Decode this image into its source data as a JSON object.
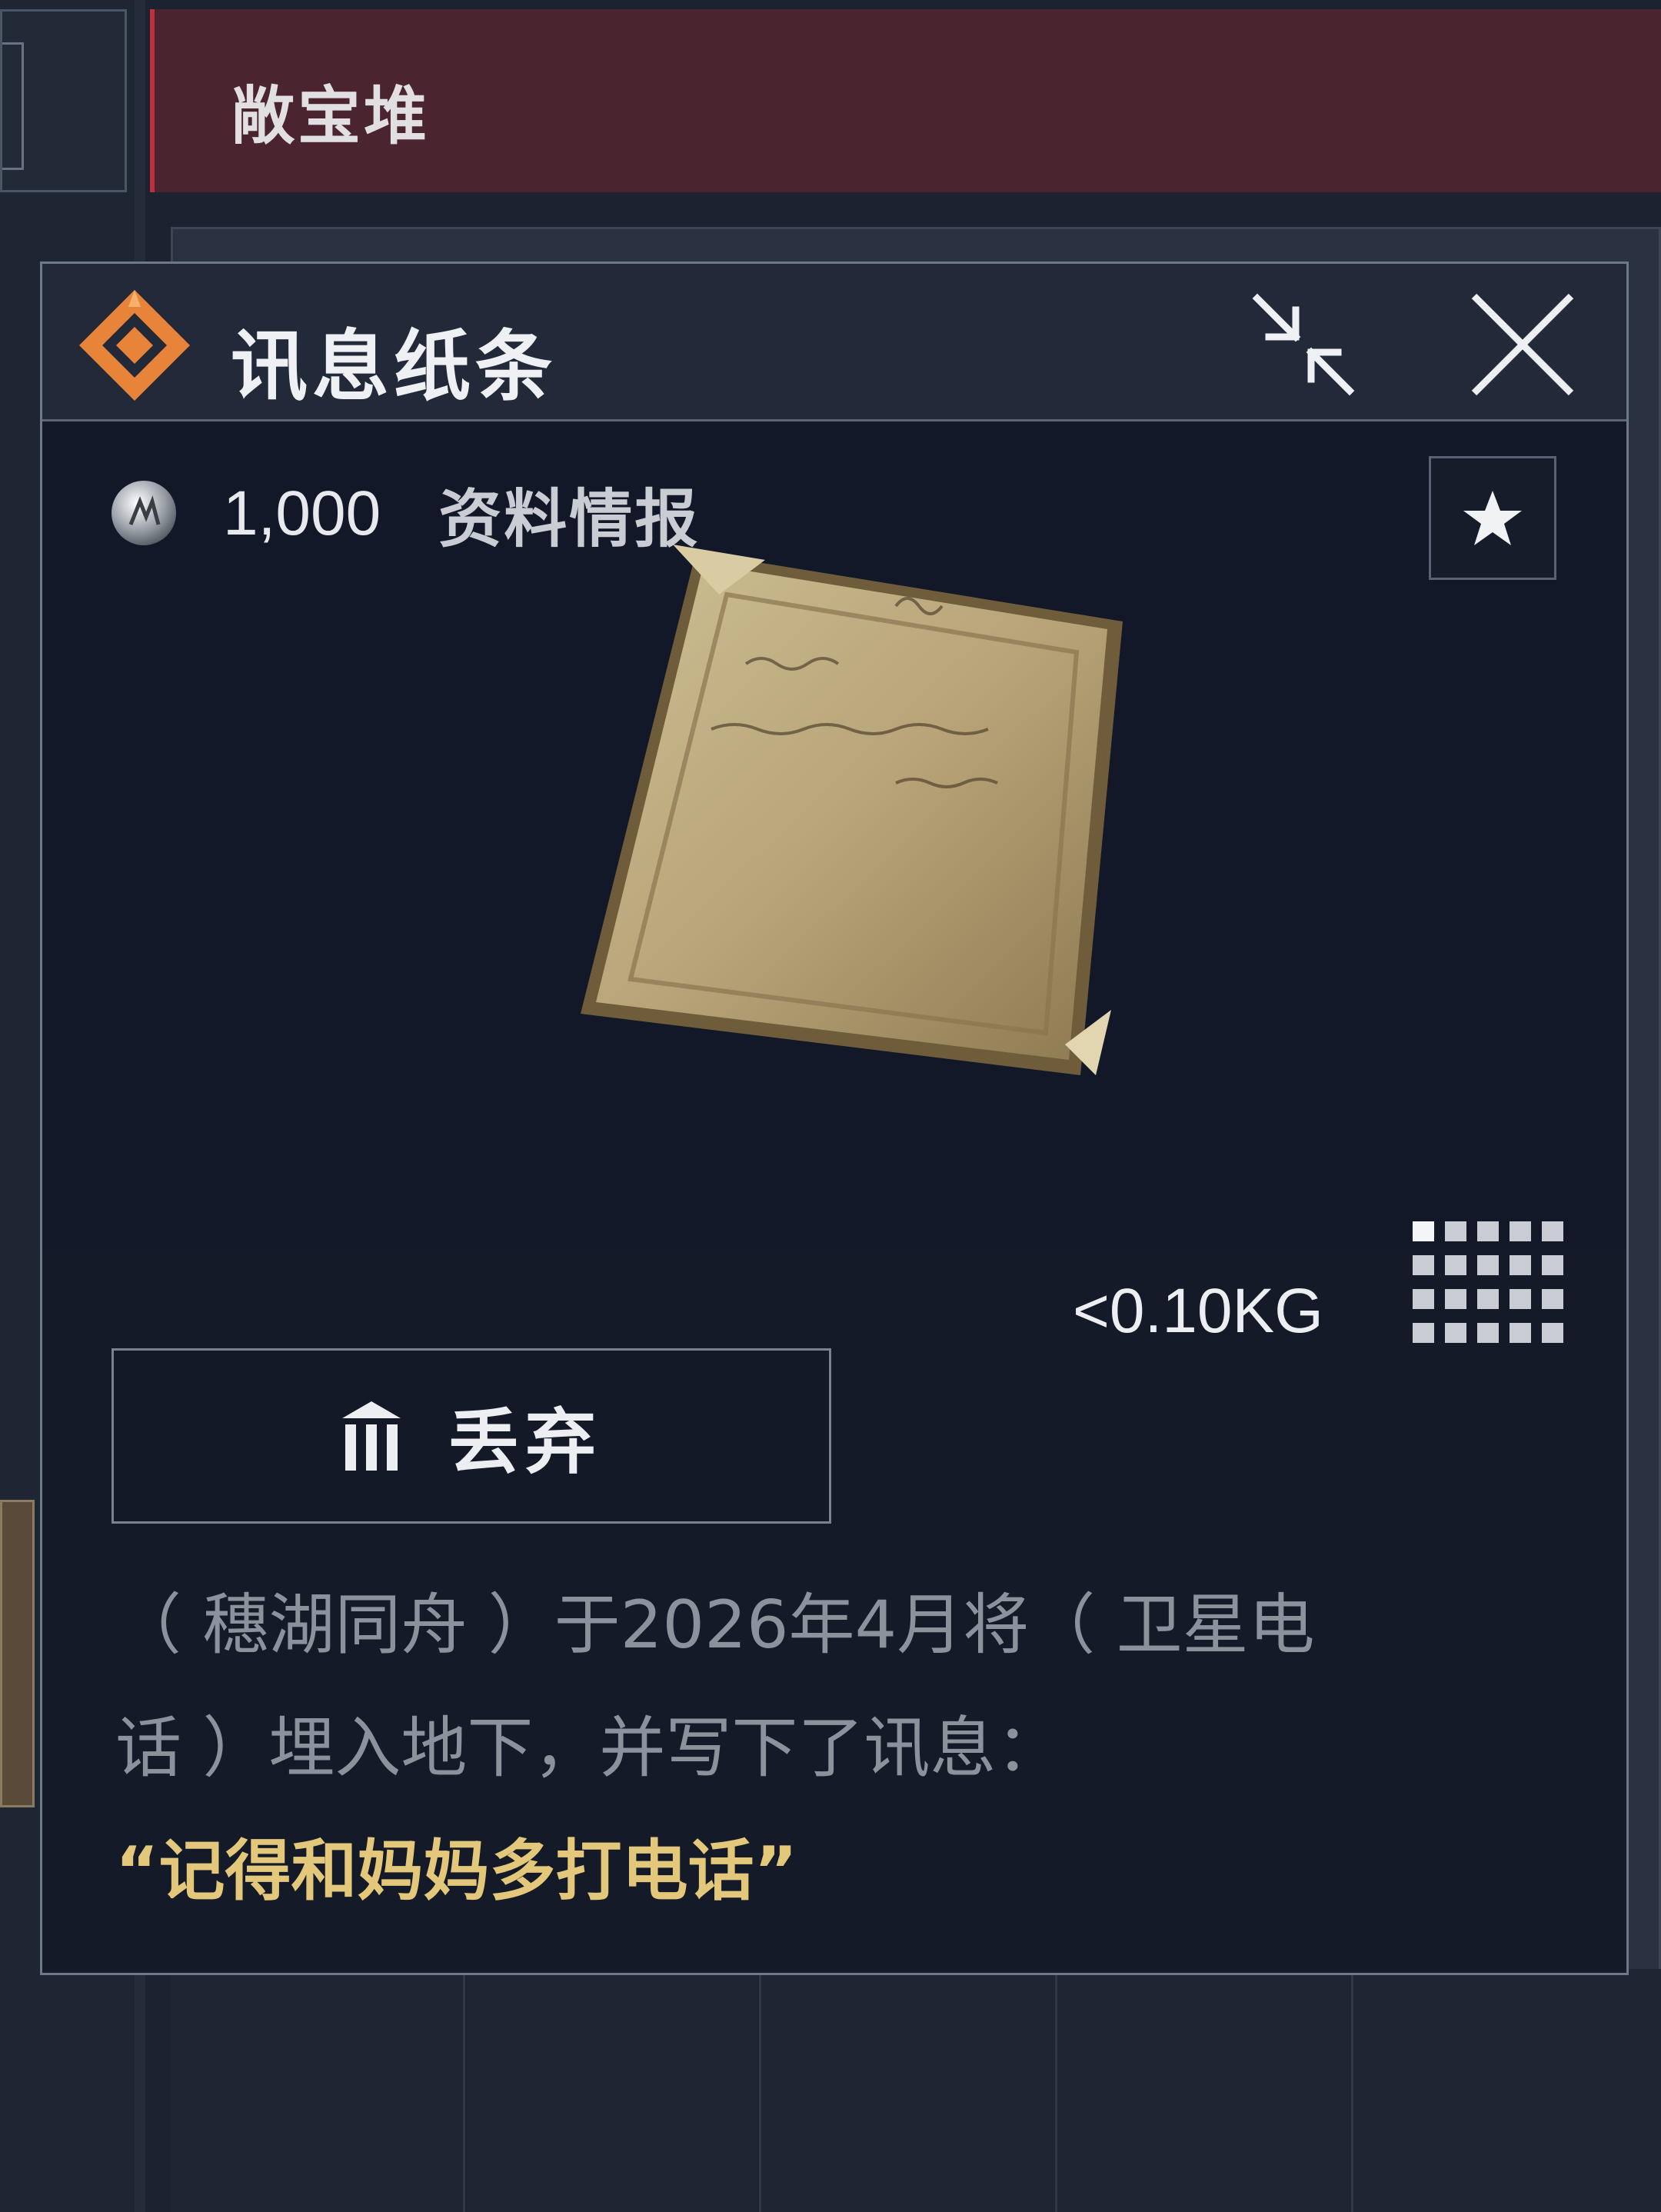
{
  "header": {
    "title": "敞宝堆"
  },
  "dialog": {
    "item_name": "讯息纸条",
    "value": "1,000",
    "category": "资料情报",
    "weight": "<0.10KG",
    "discard_label": "丢弃",
    "description_lines": [
      "（ 穗湖同舟 ）于2026年4月将（ 卫星电",
      "话 ）埋入地下，并写下了讯息："
    ],
    "quote": "“记得和妈妈多打电话”"
  },
  "colors": {
    "header_bg": "#4a2530",
    "header_accent": "#c0303a",
    "rarity_orange": "#e8843a",
    "quote_gold": "#e3c77a",
    "dialog_bg": "#141a27"
  },
  "icons": {
    "rarity": "diamond-rarity-icon",
    "collapse": "collapse-arrows-icon",
    "close": "close-x-icon",
    "coin": "coin-icon",
    "favorite": "star-icon",
    "size_grid": "grid-size-icon",
    "discard": "trash-icon"
  }
}
